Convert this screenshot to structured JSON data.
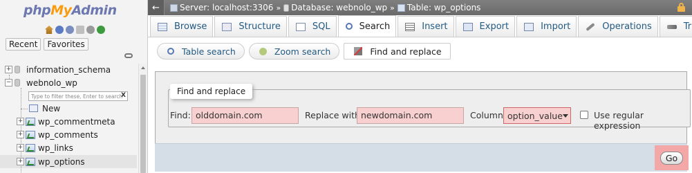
{
  "nav": {
    "logo_part1": "php",
    "logo_part2": "My",
    "logo_part3": "Admin",
    "tab_recent": "Recent",
    "tab_favorites": "Favorites",
    "tree": {
      "db1": "information_schema",
      "db2": "webnolo_wp",
      "filter_placeholder": "Type to filter these, Enter to search",
      "filter_clear": "X",
      "new_label": "New",
      "tables": [
        "wp_commentmeta",
        "wp_comments",
        "wp_links",
        "wp_options"
      ],
      "selected_table": "wp_options"
    }
  },
  "breadcrumb": {
    "back_icon": "←",
    "server": "Server: localhost:3306",
    "database": "Database: webnolo_wp",
    "table": "Table: wp_options",
    "separator": "»"
  },
  "tabs": {
    "browse": "Browse",
    "structure": "Structure",
    "sql": "SQL",
    "search": "Search",
    "insert": "Insert",
    "export": "Export",
    "import": "Import",
    "operations": "Operations",
    "triggers": "Triggers",
    "active": "Search"
  },
  "subtabs": {
    "table_search": "Table search",
    "zoom_search": "Zoom search",
    "find_replace": "Find and replace",
    "active": "Find and replace"
  },
  "form": {
    "legend": "Find and replace",
    "find_label": "Find:",
    "find_value": "olddomain.com",
    "replace_label": "Replace with:",
    "replace_value": "newdomain.com",
    "column_label": "Column:",
    "column_value": "option_value",
    "regex_label": "Use regular expression",
    "regex_checked": false,
    "go_label": "Go"
  },
  "colors": {
    "link": "#235a81",
    "highlight": "#f8d0d0",
    "topbar": "#737373"
  }
}
